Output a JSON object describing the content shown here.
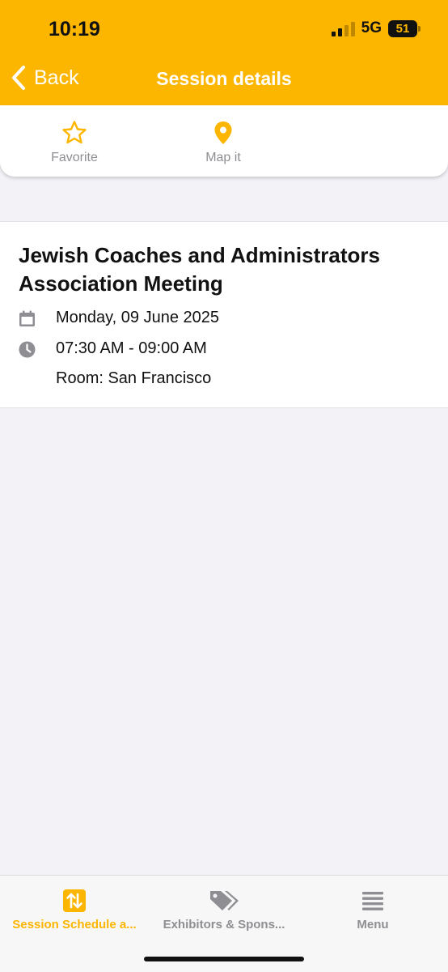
{
  "status_bar": {
    "time": "10:19",
    "network": "5G",
    "battery": "51"
  },
  "nav": {
    "back_label": "Back",
    "title": "Session details"
  },
  "actions": [
    {
      "label": "Favorite",
      "icon": "star-icon"
    },
    {
      "label": "Map it",
      "icon": "map-pin-icon"
    }
  ],
  "session": {
    "title": "Jewish Coaches and Administrators Association Meeting",
    "date": "Monday, 09 June 2025",
    "time": "07:30 AM - 09:00 AM",
    "room": "Room: San Francisco"
  },
  "tabs": [
    {
      "label": "Session Schedule a...",
      "icon": "sort-arrows-icon",
      "active": true
    },
    {
      "label": "Exhibitors & Spons...",
      "icon": "tags-icon",
      "active": false
    },
    {
      "label": "Menu",
      "icon": "menu-icon",
      "active": false
    }
  ],
  "colors": {
    "accent": "#fdb600",
    "muted": "#8e8e93",
    "background": "#f2f2f7"
  }
}
